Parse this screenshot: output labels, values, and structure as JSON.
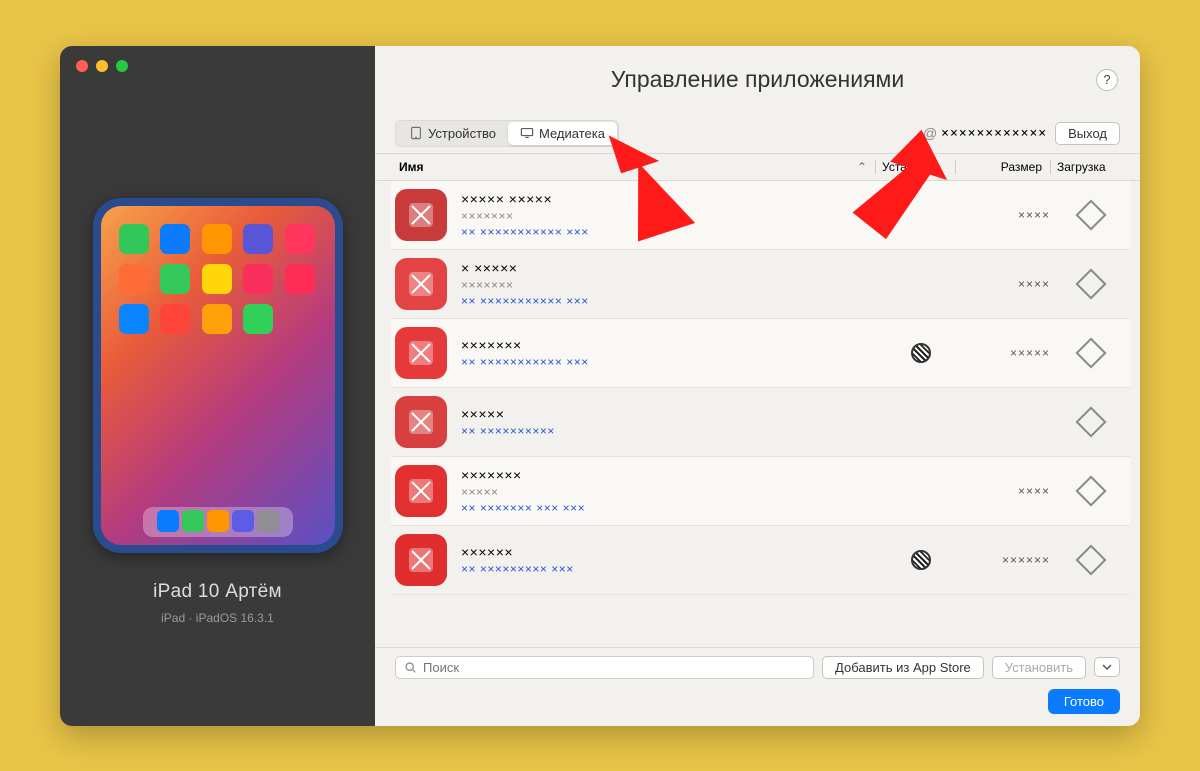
{
  "device": {
    "name": "iPad 10 Артём",
    "subtitle": "iPad · iPadOS 16.3.1"
  },
  "header": {
    "title": "Управление приложениями"
  },
  "toolbar": {
    "tab_device": "Устройство",
    "tab_library": "Медиатека",
    "account": "××××××××××××",
    "logout": "Выход"
  },
  "columns": {
    "name": "Имя",
    "installed": "Установ...",
    "size": "Размер",
    "download": "Загрузка"
  },
  "apps": [
    {
      "name": "××××× ×××××",
      "sub": "×××××××",
      "desc": "×× ××××××××××× ×××",
      "size": "××××",
      "installed": false
    },
    {
      "name": "× ×××××",
      "sub": "×××××××",
      "desc": "×× ××××××××××× ×××",
      "size": "××××",
      "installed": false
    },
    {
      "name": "×××××××",
      "sub": "",
      "desc": "×× ××××××××××× ×××",
      "size": "×××××",
      "installed": true
    },
    {
      "name": "×××××",
      "sub": "",
      "desc": "×× ××××××××××",
      "size": "",
      "installed": false
    },
    {
      "name": "×××××××",
      "sub": "×××××",
      "desc": "×× ××××××× ××× ×××",
      "size": "××××",
      "installed": false
    },
    {
      "name": "××××××",
      "sub": "",
      "desc": "×× ××××××××× ×××",
      "size": "××××××",
      "installed": true
    }
  ],
  "footer": {
    "search_placeholder": "Поиск",
    "add_from": "Добавить из App Store",
    "install": "Установить",
    "done": "Готово"
  },
  "colors": {
    "app_icons": [
      "#c83b3a",
      "#e24343",
      "#e63a3a",
      "#d84040",
      "#e23030",
      "#e02e2e"
    ]
  }
}
